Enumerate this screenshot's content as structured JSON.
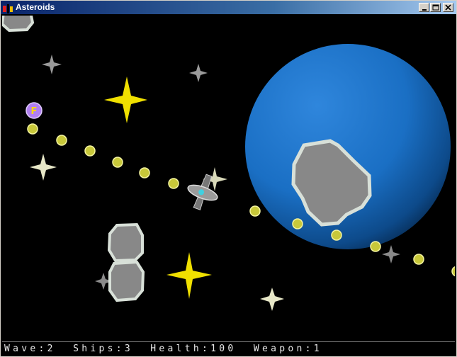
{
  "window": {
    "title": "Asteroids",
    "app_icon": "asteroids-app-icon",
    "controls": [
      "minimize-icon",
      "maximize-icon",
      "close-icon"
    ]
  },
  "powerup": {
    "letter": "F",
    "color": "#b07ff0"
  },
  "status": {
    "wave_label": "Wave",
    "wave": "2",
    "ships_label": "Ships",
    "ships": "3",
    "health_label": "Health",
    "health": "100",
    "weapon_label": "Weapon",
    "weapon": "1"
  },
  "colors": {
    "background": "#000000",
    "planet": "#1a6fc4",
    "asteroid_fill": "#888888",
    "asteroid_outline": "#d8e0d8",
    "bullet": "#c8c83a",
    "star_yellow": "#f0e000",
    "star_white": "#e8e8c8",
    "star_grey": "#9a9a9a"
  }
}
